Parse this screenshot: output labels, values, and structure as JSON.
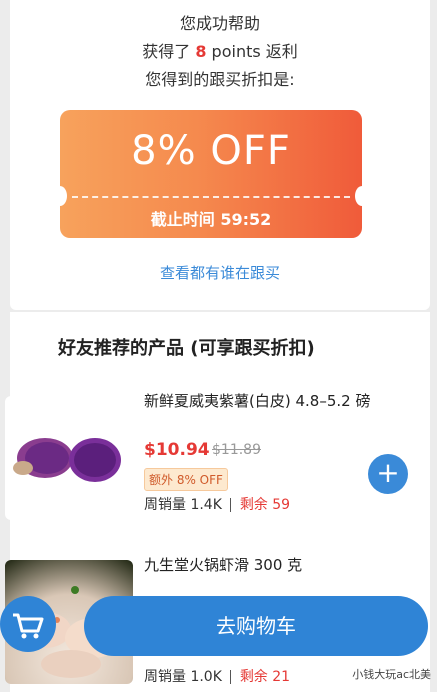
{
  "top": {
    "line1": "您成功帮助",
    "line2_prefix": "获得了",
    "line2_num": "8",
    "line2_suffix": "points 返利",
    "line3": "您得到的跟买折扣是:"
  },
  "coupon": {
    "off_text": "8% OFF",
    "deadline_label": "截止时间",
    "deadline_time": "59:52"
  },
  "see_link": "查看都有谁在跟买",
  "section": {
    "title": "好友推荐的产品 (可享跟买折扣)"
  },
  "products": [
    {
      "name": "新鲜夏威夷紫薯(白皮) 4.8–5.2 磅",
      "price": "$10.94",
      "old_price": "$11.89",
      "extra": "额外 8% OFF",
      "sales_label": "周销量",
      "sales_value": "1.4K",
      "remain_label": "剩余",
      "remain_value": "59"
    },
    {
      "name": "九生堂火锅虾滑 300 克",
      "sales_label": "周销量",
      "sales_value": "1.0K",
      "remain_label": "剩余",
      "remain_value": "21"
    }
  ],
  "cart": {
    "label": "去购物车"
  },
  "watermark": "小钱大玩ac北美",
  "colors": {
    "accent": "#2f84d6",
    "price_red": "#e53935",
    "coupon_from": "#f7a25c",
    "coupon_to": "#f05b3a"
  }
}
